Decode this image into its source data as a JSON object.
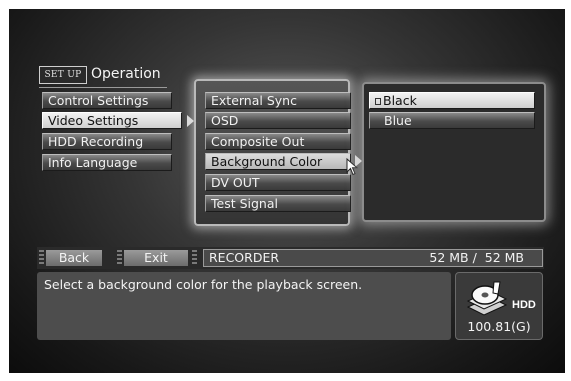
{
  "header": {
    "setup_label": "SET UP",
    "title": "Operation"
  },
  "left_menu": [
    {
      "label": "Control Settings"
    },
    {
      "label": "Video Settings"
    },
    {
      "label": "HDD Recording"
    },
    {
      "label": "Info Language"
    }
  ],
  "video_menu": [
    {
      "label": "External Sync"
    },
    {
      "label": "OSD"
    },
    {
      "label": "Composite Out"
    },
    {
      "label": "Background Color"
    },
    {
      "label": "DV OUT"
    },
    {
      "label": "Test Signal"
    }
  ],
  "options": [
    {
      "label": "Black",
      "selected": true
    },
    {
      "label": "Blue"
    }
  ],
  "status": {
    "back_label": "Back",
    "exit_label": "Exit",
    "mode": "RECORDER",
    "size": "52 MB /  52 MB"
  },
  "message": "Select a background color for the playback screen.",
  "hdd": {
    "label": "HDD",
    "capacity": "100.81(G)"
  },
  "colors": {
    "panel_glow": "#e6e6e6",
    "selected_bg": "#f2f2f2",
    "button_bg": "#4a4a4a"
  }
}
